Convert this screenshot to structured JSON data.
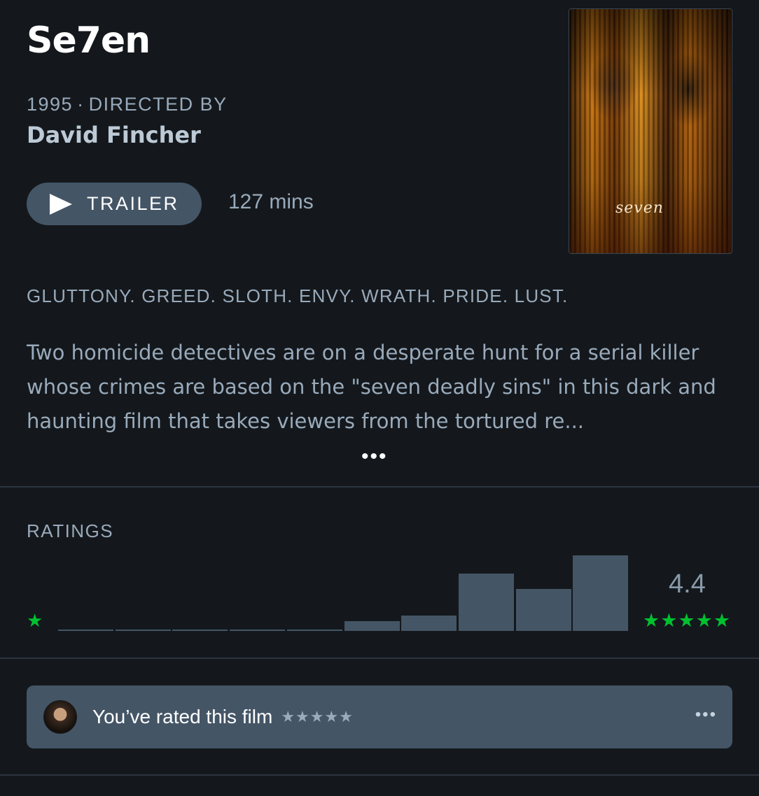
{
  "film": {
    "title": "Se7en",
    "year": "1995",
    "directed_by_label": "DIRECTED BY",
    "separator": "·",
    "director": "David Fincher",
    "trailer_label": "TRAILER",
    "runtime": "127 mins",
    "poster_title": "seven",
    "tagline": "GLUTTONY. GREED. SLOTH. ENVY. WRATH. PRIDE. LUST.",
    "synopsis": "Two homicide detectives are on a desperate hunt for a serial killer whose crimes are based on the \"seven deadly sins\" in this dark and haunting film that takes viewers from the tortured re...",
    "more_label": "•••"
  },
  "ratings": {
    "title": "RATINGS",
    "low_star": "★",
    "average": "4.4",
    "high_stars": "★★★★★",
    "histogram_fractions": [
      0.02,
      0.02,
      0.02,
      0.02,
      0.02,
      0.13,
      0.2,
      0.76,
      0.56,
      1.0
    ]
  },
  "user_rating": {
    "text": "You’ve rated this film",
    "stars": "★★★★★",
    "more_label": "•••"
  },
  "colors": {
    "background": "#14181c",
    "accent_green": "#00c030",
    "button_bg": "#445566",
    "text_muted": "#99aabb"
  },
  "icons": {
    "play": "play-icon",
    "star": "star-icon",
    "more": "more-dots-icon"
  }
}
